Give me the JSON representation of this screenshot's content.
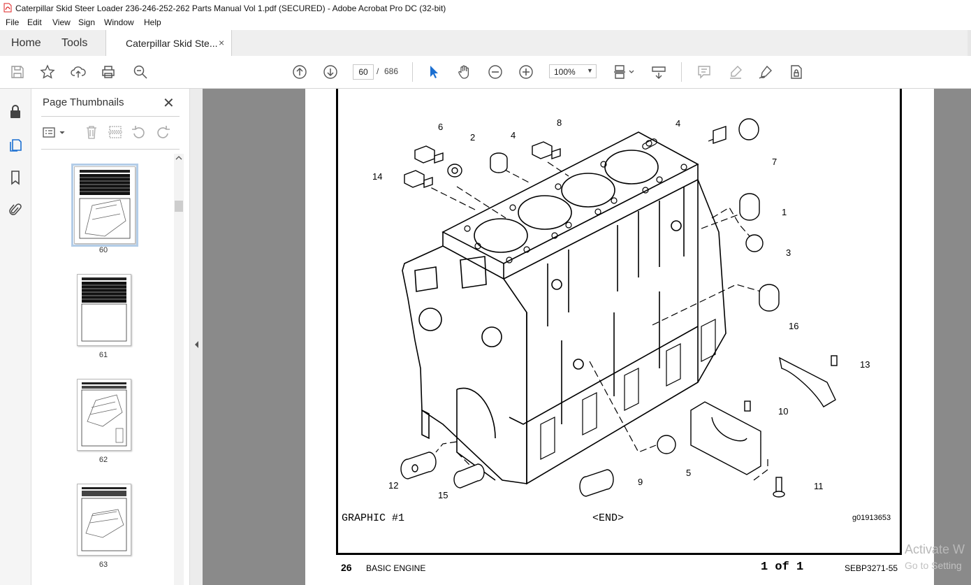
{
  "window": {
    "title": "Caterpillar Skid Steer Loader 236-246-252-262 Parts Manual Vol 1.pdf (SECURED) - Adobe Acrobat Pro DC (32-bit)"
  },
  "menu": [
    "File",
    "Edit",
    "View",
    "Sign",
    "Window",
    "Help"
  ],
  "nav_tabs": {
    "home": "Home",
    "tools": "Tools"
  },
  "doc_tab": {
    "label": "Caterpillar Skid Ste...",
    "close": "×"
  },
  "toolbar": {
    "current_page": "60",
    "separator": "/",
    "page_count": "686",
    "zoom": "100%",
    "icons": [
      "save-icon",
      "bookmark-star-icon",
      "upload-icon",
      "print-icon",
      "zoom-search-icon",
      "page-up-icon",
      "page-down-icon",
      "select-cursor-icon",
      "hand-icon",
      "zoom-out-icon",
      "zoom-in-icon",
      "page-layout-icon",
      "scroll-mode-icon",
      "comment-icon",
      "highlight-icon",
      "sign-icon",
      "protect-icon"
    ]
  },
  "left_rail": [
    "lock-icon",
    "pages-icon",
    "bookmarks-icon",
    "attachments-icon"
  ],
  "thumbnails_panel": {
    "title": "Page Thumbnails",
    "close": "✕",
    "pages": [
      {
        "label": "60",
        "selected": true
      },
      {
        "label": "61",
        "selected": false
      },
      {
        "label": "62",
        "selected": false
      },
      {
        "label": "63",
        "selected": false
      }
    ]
  },
  "document": {
    "graphic_label": "GRAPHIC #1",
    "end_label": "<END>",
    "figure_ref": "g01913653",
    "page_number": "26",
    "section": "BASIC ENGINE",
    "page_of": "1 of 1",
    "doc_id": "SEBP3271-55",
    "callouts": [
      "1",
      "2",
      "3",
      "4",
      "4",
      "5",
      "6",
      "7",
      "8",
      "9",
      "10",
      "11",
      "12",
      "13",
      "14",
      "15",
      "16"
    ]
  },
  "watermark": {
    "line1": "Activate W",
    "line2": "Go to Setting"
  }
}
